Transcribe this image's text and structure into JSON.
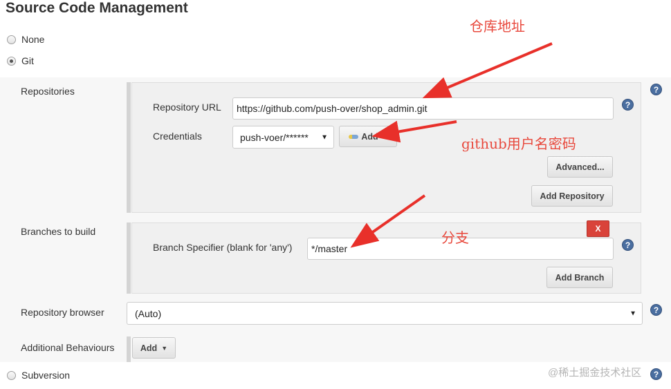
{
  "header": {
    "title": "Source Code Management"
  },
  "scm_options": {
    "none": "None",
    "git": "Git",
    "subversion": "Subversion"
  },
  "repositories": {
    "label": "Repositories",
    "url_label": "Repository URL",
    "url_value": "https://github.com/push-over/shop_admin.git",
    "credentials_label": "Credentials",
    "credentials_value": "push-voer/******",
    "add_label": "Add",
    "advanced_label": "Advanced...",
    "add_repository_label": "Add Repository"
  },
  "branches": {
    "label": "Branches to build",
    "x_label": "X",
    "specifier_label": "Branch Specifier (blank for 'any')",
    "specifier_value": "*/master",
    "add_branch_label": "Add Branch"
  },
  "repository_browser": {
    "label": "Repository browser",
    "value": "(Auto)"
  },
  "additional_behaviours": {
    "label": "Additional Behaviours",
    "add_label": "Add"
  },
  "annotations": {
    "repo_address": "仓库地址",
    "github_credentials": "github用户名密码",
    "branch": "分支",
    "arrow_color": "#e8302a"
  },
  "help_icon_glyph": "?",
  "watermark": "@稀土掘金技术社区"
}
